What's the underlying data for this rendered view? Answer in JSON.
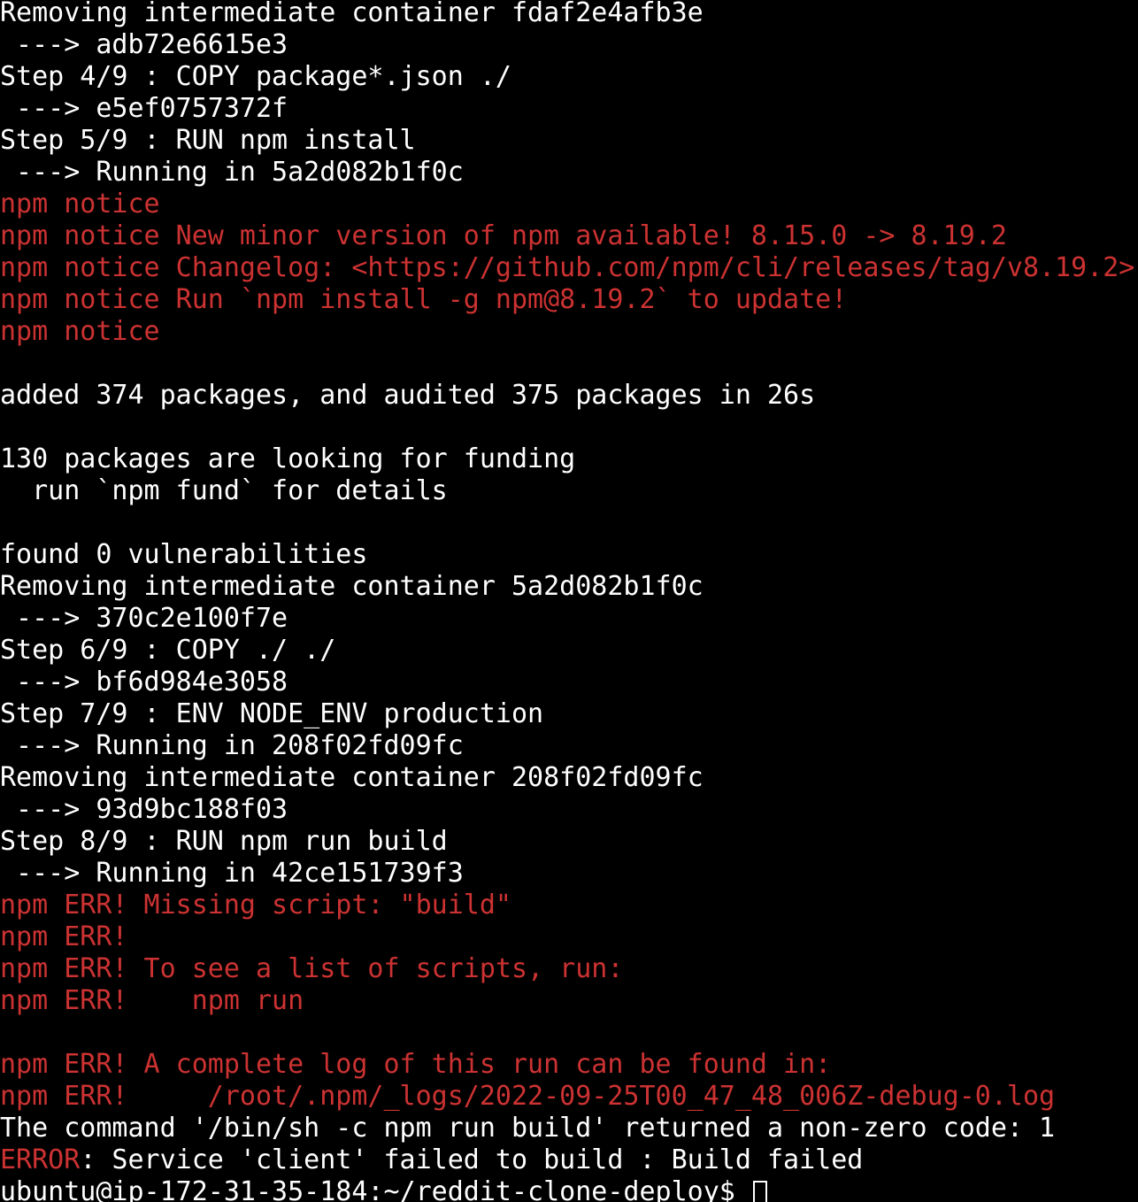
{
  "terminal": {
    "colors": {
      "background": "#000000",
      "foreground": "#ffffff",
      "red": "#cc3232"
    },
    "prompt": "ubuntu@ip-172-31-35-184:~/reddit-clone-deploy$ ",
    "cursor": "block-outline-cursor",
    "lines": [
      {
        "text": "Removing intermediate container fdaf2e4afb3e",
        "color": "white"
      },
      {
        "text": " ---> adb72e6615e3",
        "color": "white"
      },
      {
        "text": "Step 4/9 : COPY package*.json ./",
        "color": "white"
      },
      {
        "text": " ---> e5ef0757372f",
        "color": "white"
      },
      {
        "text": "Step 5/9 : RUN npm install",
        "color": "white"
      },
      {
        "text": " ---> Running in 5a2d082b1f0c",
        "color": "white"
      },
      {
        "text": "npm notice",
        "color": "red"
      },
      {
        "text": "npm notice New minor version of npm available! 8.15.0 -> 8.19.2",
        "color": "red"
      },
      {
        "text": "npm notice Changelog: <https://github.com/npm/cli/releases/tag/v8.19.2>",
        "color": "red"
      },
      {
        "text": "npm notice Run `npm install -g npm@8.19.2` to update!",
        "color": "red"
      },
      {
        "text": "npm notice",
        "color": "red"
      },
      {
        "text": "",
        "color": "white"
      },
      {
        "text": "added 374 packages, and audited 375 packages in 26s",
        "color": "white"
      },
      {
        "text": "",
        "color": "white"
      },
      {
        "text": "130 packages are looking for funding",
        "color": "white"
      },
      {
        "text": "  run `npm fund` for details",
        "color": "white"
      },
      {
        "text": "",
        "color": "white"
      },
      {
        "text": "found 0 vulnerabilities",
        "color": "white"
      },
      {
        "text": "Removing intermediate container 5a2d082b1f0c",
        "color": "white"
      },
      {
        "text": " ---> 370c2e100f7e",
        "color": "white"
      },
      {
        "text": "Step 6/9 : COPY ./ ./",
        "color": "white"
      },
      {
        "text": " ---> bf6d984e3058",
        "color": "white"
      },
      {
        "text": "Step 7/9 : ENV NODE_ENV production",
        "color": "white"
      },
      {
        "text": " ---> Running in 208f02fd09fc",
        "color": "white"
      },
      {
        "text": "Removing intermediate container 208f02fd09fc",
        "color": "white"
      },
      {
        "text": " ---> 93d9bc188f03",
        "color": "white"
      },
      {
        "text": "Step 8/9 : RUN npm run build",
        "color": "white"
      },
      {
        "text": " ---> Running in 42ce151739f3",
        "color": "white"
      },
      {
        "text": "npm ERR! Missing script: \"build\"",
        "color": "red"
      },
      {
        "text": "npm ERR!",
        "color": "red"
      },
      {
        "text": "npm ERR! To see a list of scripts, run:",
        "color": "red"
      },
      {
        "text": "npm ERR!    npm run",
        "color": "red"
      },
      {
        "text": "",
        "color": "white"
      },
      {
        "text": "npm ERR! A complete log of this run can be found in:",
        "color": "red"
      },
      {
        "text": "npm ERR!     /root/.npm/_logs/2022-09-25T00_47_48_006Z-debug-0.log",
        "color": "red"
      },
      {
        "text": "The command '/bin/sh -c npm run build' returned a non-zero code: 1",
        "color": "white"
      },
      {
        "text": "ERROR: Service 'client' failed to build : Build failed",
        "color": "mixed",
        "segments": [
          {
            "text": "ERROR",
            "color": "red"
          },
          {
            "text": ": Service 'client' failed to build : Build failed",
            "color": "white"
          }
        ]
      }
    ]
  }
}
